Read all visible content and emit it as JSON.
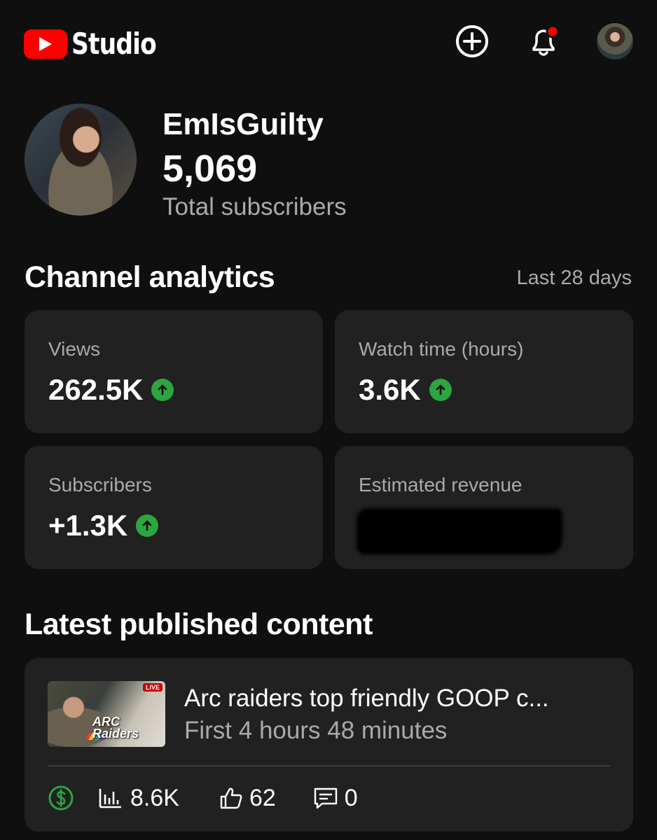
{
  "header": {
    "logo_text": "Studio",
    "icons": [
      "youtube-logo-icon",
      "create-plus-icon",
      "bell-icon",
      "account-avatar"
    ],
    "notification_dot_color": "#ff0000"
  },
  "channel": {
    "name": "EmIsGuilty",
    "subscribers": "5,069",
    "subscribers_label": "Total subscribers"
  },
  "analytics": {
    "title": "Channel analytics",
    "period": "Last 28 days",
    "cards": [
      {
        "label": "Views",
        "value": "262.5K",
        "trend": "up"
      },
      {
        "label": "Watch time (hours)",
        "value": "3.6K",
        "trend": "up"
      },
      {
        "label": "Subscribers",
        "value": "+1.3K",
        "trend": "up"
      },
      {
        "label": "Estimated revenue",
        "value": "",
        "redacted": true
      }
    ],
    "trend_color": "#2ba640"
  },
  "latest": {
    "title": "Latest published content",
    "video": {
      "title": "Arc raiders top friendly GOOP c...",
      "subtitle": "First 4 hours 48 minutes",
      "thumbnail_badge": "LIVE",
      "thumbnail_text": "ARC Raiders",
      "views": "8.6K",
      "likes": "62",
      "comments": "0",
      "monetized_color": "#2ba640"
    }
  }
}
